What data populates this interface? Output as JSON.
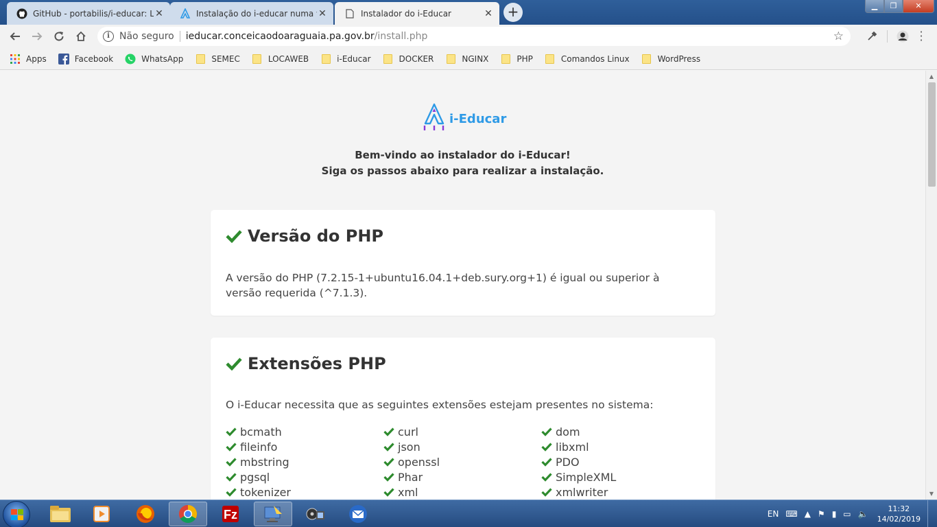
{
  "browser": {
    "tabs": [
      {
        "title": "GitHub - portabilis/i-educar: Lanç",
        "icon": "github-icon",
        "active": false
      },
      {
        "title": "Instalação do i-educar numa vps",
        "icon": "ieducar-favicon",
        "active": false
      },
      {
        "title": "Instalador do i-Educar",
        "icon": "page-icon",
        "active": true
      }
    ],
    "new_tab": "+",
    "address": {
      "security_label": "Não seguro",
      "host": "ieducar.conceicaodoaraguaia.pa.gov.br",
      "path": "/install.php"
    },
    "bookmarks": [
      {
        "label": "Apps",
        "icon": "apps-grid-icon"
      },
      {
        "label": "Facebook",
        "icon": "facebook-icon"
      },
      {
        "label": "WhatsApp",
        "icon": "whatsapp-icon"
      },
      {
        "label": "SEMEC",
        "icon": "folder-icon"
      },
      {
        "label": "LOCAWEB",
        "icon": "folder-icon"
      },
      {
        "label": "i-Educar",
        "icon": "folder-icon"
      },
      {
        "label": "DOCKER",
        "icon": "folder-icon"
      },
      {
        "label": "NGINX",
        "icon": "folder-icon"
      },
      {
        "label": "PHP",
        "icon": "folder-icon"
      },
      {
        "label": "Comandos Linux",
        "icon": "folder-icon"
      },
      {
        "label": "WordPress",
        "icon": "folder-icon"
      }
    ]
  },
  "page": {
    "logo_text": "i-Educar",
    "welcome_line1": "Bem-vindo ao instalador do i-Educar!",
    "welcome_line2": "Siga os passos abaixo para realizar a instalação.",
    "php_card": {
      "title": "Versão do PHP",
      "status": "ok",
      "text": "A versão do PHP (7.2.15-1+ubuntu16.04.1+deb.sury.org+1) é igual ou superior à versão requerida (^7.1.3)."
    },
    "ext_card": {
      "title": "Extensões PHP",
      "status": "ok",
      "text": "O i-Educar necessita que as seguintes extensões estejam presentes no sistema:",
      "extensions": [
        "bcmath",
        "curl",
        "dom",
        "fileinfo",
        "json",
        "libxml",
        "mbstring",
        "openssl",
        "PDO",
        "pgsql",
        "Phar",
        "SimpleXML",
        "tokenizer",
        "xml",
        "xmlwriter"
      ]
    }
  },
  "taskbar": {
    "language": "EN",
    "time": "11:32",
    "date": "14/02/2019",
    "apps": [
      "start-button",
      "file-explorer-icon",
      "media-player-icon",
      "firefox-icon",
      "chrome-icon",
      "filezilla-icon",
      "remote-desktop-icon",
      "video-editor-icon",
      "thunderbird-icon"
    ]
  },
  "colors": {
    "check_green": "#2e8b2e",
    "logo_blue": "#2e9ae6",
    "logo_purple": "#8a3ad6",
    "titlebar_blue": "#2f5f9a"
  }
}
